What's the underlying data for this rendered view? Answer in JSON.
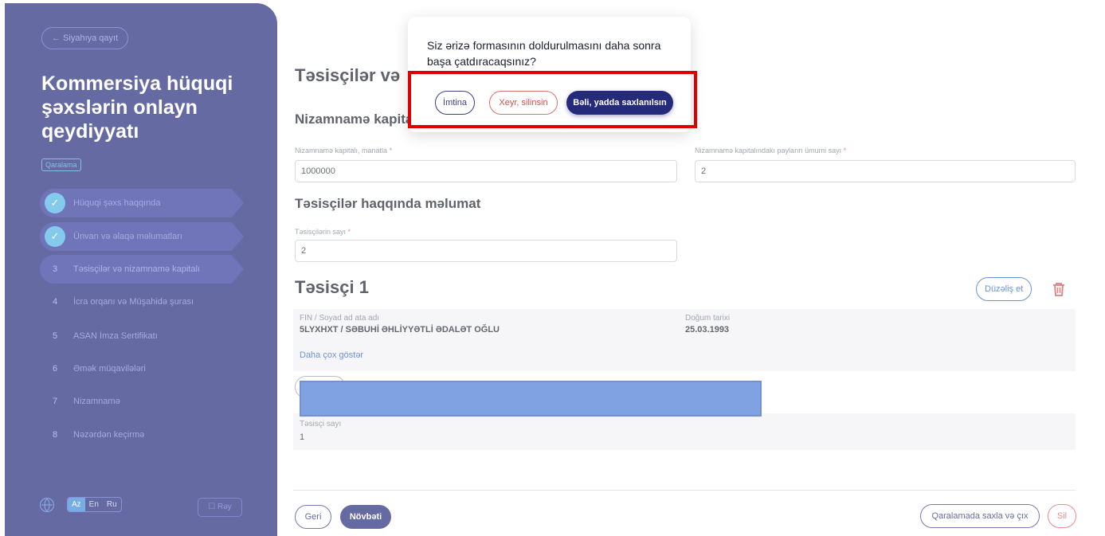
{
  "sidebar": {
    "back_label": "← Siyahıya qayıt",
    "title": "Kommersiya hüquqi şəxslərin onlayn qeydiyyatı",
    "draft_badge": "Qaralama",
    "steps": [
      {
        "num": "✓",
        "label": "Hüquqi şəxs haqqında",
        "state": "done"
      },
      {
        "num": "✓",
        "label": "Ünvan və əlaqə məlumatları",
        "state": "done"
      },
      {
        "num": "3",
        "label": "Təsisçilər və nizamnamə kapitalı",
        "state": "active"
      },
      {
        "num": "4",
        "label": "İcra orqanı və Müşahidə şurası",
        "state": "pending"
      },
      {
        "num": "5",
        "label": "ASAN İmza Sertifikatı",
        "state": "pending"
      },
      {
        "num": "6",
        "label": "Əmək müqavilələri",
        "state": "pending"
      },
      {
        "num": "7",
        "label": "Nizamnamə",
        "state": "pending"
      },
      {
        "num": "8",
        "label": "Nəzərdən keçirmə",
        "state": "pending"
      }
    ],
    "languages": [
      "Az",
      "En",
      "Ru"
    ],
    "selected_language": "Az",
    "feedback_label": "☐ Rəy"
  },
  "main": {
    "page_title": "Təsisçilər və",
    "charter_section_title": "Nizamnamə kapita",
    "charter_capital_label": "Nizamnamə kapitalı, manatla",
    "charter_capital_value": "1000000",
    "shares_total_label": "Nizamnamə kapitalındakı payların ümumi sayı",
    "shares_total_value": "2",
    "founders_section_title": "Təsisçilər haqqında məlumat",
    "founders_count_label": "Təsisçilərin sayı",
    "founders_count_value": "2",
    "required_mark": "*",
    "founder_heading": "Təsisçi 1",
    "edit_label": "Düzəliş et",
    "founder_card": {
      "fin_label": "FIN / Soyad ad ata adı",
      "fin_value": "5LYXHXT / SƏBUHİ ƏHLİYYƏTLİ ƏDALƏT OĞLU",
      "dob_label": "Doğum tarixi",
      "dob_value": "25.03.1993",
      "more_label": "Daha çox göstər"
    },
    "founder_count_card": {
      "label": "Təsisçi sayı",
      "value": "1"
    },
    "back_button": "Geri",
    "next_button": "Növbəti",
    "save_exit_button": "Qaralamada saxla və çıx",
    "delete_button": "Sil"
  },
  "modal": {
    "question": "Siz ərizə formasının doldurulmasını daha sonra başa çatdıracaqsınız?",
    "cancel_label": "İmtina",
    "no_label": "Xeyr, silinsin",
    "yes_label": "Bəli, yadda saxlanılsın"
  },
  "colors": {
    "brand": "#252a7a",
    "accent_blue": "#2b62c9",
    "danger": "#e25a5a",
    "highlight": "#e00000"
  }
}
